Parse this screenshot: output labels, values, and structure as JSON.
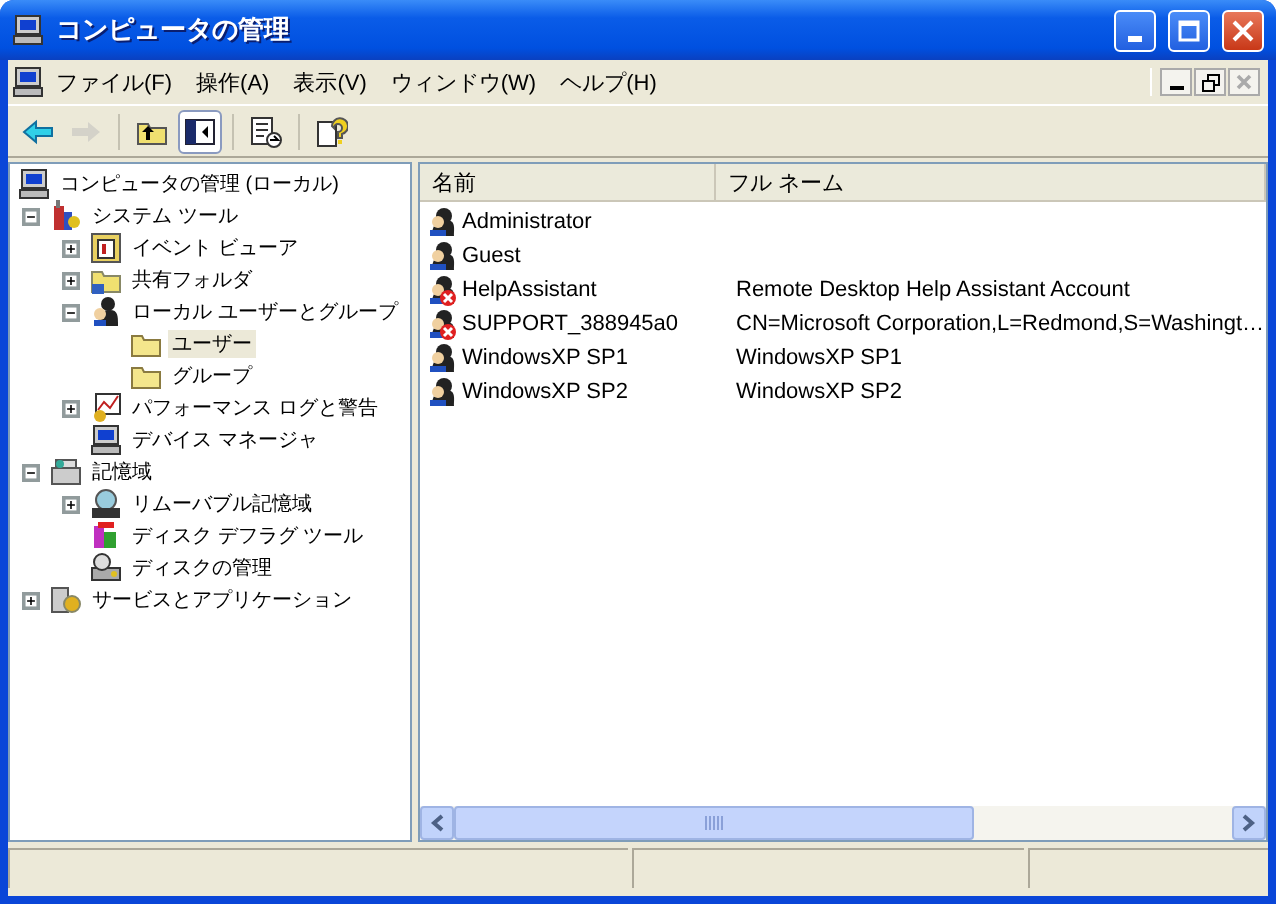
{
  "window": {
    "title": "コンピュータの管理"
  },
  "menu": [
    {
      "label": "ファイル(F)"
    },
    {
      "label": "操作(A)"
    },
    {
      "label": "表示(V)"
    },
    {
      "label": "ウィンドウ(W)"
    },
    {
      "label": "ヘルプ(H)"
    }
  ],
  "toolbar": [
    {
      "kind": "back",
      "disabled": false,
      "pressed": false
    },
    {
      "kind": "forward",
      "disabled": true,
      "pressed": false
    },
    {
      "kind": "sep"
    },
    {
      "kind": "up",
      "disabled": false,
      "pressed": false
    },
    {
      "kind": "tree",
      "disabled": false,
      "pressed": true
    },
    {
      "kind": "sep"
    },
    {
      "kind": "export",
      "disabled": false,
      "pressed": false
    },
    {
      "kind": "sep"
    },
    {
      "kind": "help",
      "disabled": false,
      "pressed": false
    }
  ],
  "tree": [
    {
      "label": "コンピュータの管理 (ローカル)",
      "kind": "computer",
      "selected": false,
      "children": [
        {
          "label": "システム ツール",
          "kind": "tools",
          "expanded": true,
          "selected": false,
          "children": [
            {
              "label": "イベント ビューア",
              "kind": "event",
              "expanded": false,
              "selected": false
            },
            {
              "label": "共有フォルダ",
              "kind": "share",
              "expanded": false,
              "selected": false
            },
            {
              "label": "ローカル ユーザーとグループ",
              "kind": "users",
              "expanded": true,
              "selected": false,
              "children": [
                {
                  "label": "ユーザー",
                  "kind": "folder",
                  "selected": true
                },
                {
                  "label": "グループ",
                  "kind": "folder",
                  "selected": false
                }
              ]
            },
            {
              "label": "パフォーマンス ログと警告",
              "kind": "perf",
              "expanded": false,
              "selected": false
            },
            {
              "label": "デバイス マネージャ",
              "kind": "device",
              "selected": false
            }
          ]
        },
        {
          "label": "記憶域",
          "kind": "storage",
          "expanded": true,
          "selected": false,
          "children": [
            {
              "label": "リムーバブル記憶域",
              "kind": "removable",
              "expanded": false,
              "selected": false
            },
            {
              "label": "ディスク デフラグ ツール",
              "kind": "defrag",
              "selected": false
            },
            {
              "label": "ディスクの管理",
              "kind": "disk",
              "selected": false
            }
          ]
        },
        {
          "label": "サービスとアプリケーション",
          "kind": "services",
          "expanded": false,
          "selected": false
        }
      ]
    }
  ],
  "list": {
    "columns": [
      "名前",
      "フル ネーム"
    ],
    "rows": [
      {
        "name": "Administrator",
        "full_name": "",
        "disabled": false
      },
      {
        "name": "Guest",
        "full_name": "",
        "disabled": false
      },
      {
        "name": "HelpAssistant",
        "full_name": "Remote Desktop Help Assistant Account",
        "disabled": true
      },
      {
        "name": "SUPPORT_388945a0",
        "full_name": "CN=Microsoft Corporation,L=Redmond,S=Washingt…",
        "disabled": true
      },
      {
        "name": "WindowsXP SP1",
        "full_name": "WindowsXP SP1",
        "disabled": false
      },
      {
        "name": "WindowsXP SP2",
        "full_name": "WindowsXP SP2",
        "disabled": false
      }
    ]
  }
}
